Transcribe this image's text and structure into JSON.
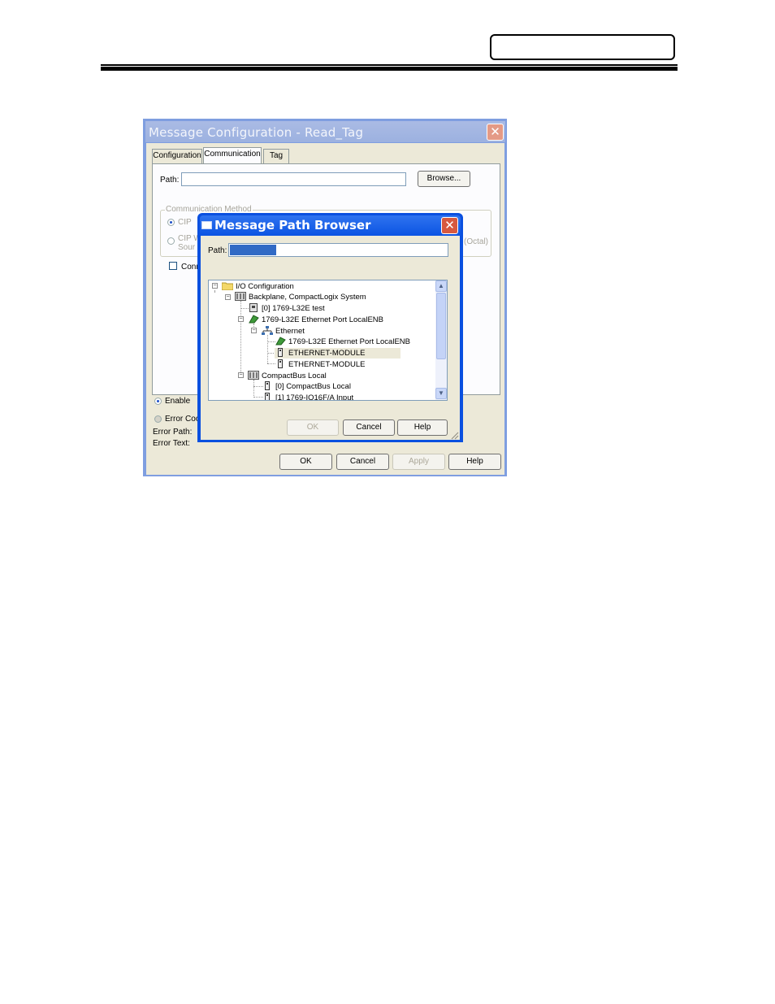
{
  "page": {
    "header_box_label": ""
  },
  "message_config": {
    "title": "Message Configuration - Read_Tag",
    "close_glyph": "✕",
    "tabs": [
      {
        "label": "Configuration"
      },
      {
        "label": "Communication"
      },
      {
        "label": "Tag"
      }
    ],
    "path_label": "Path:",
    "path_value": "",
    "browse_label": "Browse...",
    "comm_method_label": "Communication Method",
    "radio_cip_label": "CIP",
    "radio_cipw_label": "CIP W",
    "radio_cipw_sub": "Sour",
    "octal_label": "(Octal)",
    "connected_label": "Conn",
    "enable_label": "Enable",
    "error_code_label": "Error Coo",
    "error_path_label": "Error Path:",
    "error_text_label": "Error Text:",
    "ok_label": "OK",
    "cancel_label": "Cancel",
    "apply_label": "Apply",
    "help_label": "Help"
  },
  "path_browser": {
    "title": "Message Path Browser",
    "close_glyph": "✕",
    "path_label": "Path:",
    "tree": [
      {
        "label": "I/O Configuration",
        "icon": "folder-icon",
        "expander": "−"
      },
      {
        "label": "Backplane, CompactLogix System",
        "icon": "backplane-icon",
        "expander": "−"
      },
      {
        "label": "[0] 1769-L32E test",
        "icon": "controller-icon",
        "expander": ""
      },
      {
        "label": "1769-L32E Ethernet Port LocalENB",
        "icon": "ethernet-port-icon",
        "expander": "−"
      },
      {
        "label": "Ethernet",
        "icon": "network-icon",
        "expander": "−"
      },
      {
        "label": "1769-L32E Ethernet Port LocalENB",
        "icon": "ethernet-port-icon",
        "expander": ""
      },
      {
        "label": "ETHERNET-MODULE",
        "icon": "module-icon",
        "expander": ""
      },
      {
        "label": "ETHERNET-MODULE",
        "icon": "module-icon",
        "expander": ""
      },
      {
        "label": "CompactBus Local",
        "icon": "backplane-icon",
        "expander": "−"
      },
      {
        "label": "[0] CompactBus Local",
        "icon": "module-icon",
        "expander": ""
      },
      {
        "label": "[1] 1769-IQ16F/A Input",
        "icon": "module-icon",
        "expander": ""
      }
    ],
    "ok_label": "OK",
    "cancel_label": "Cancel",
    "help_label": "Help"
  }
}
